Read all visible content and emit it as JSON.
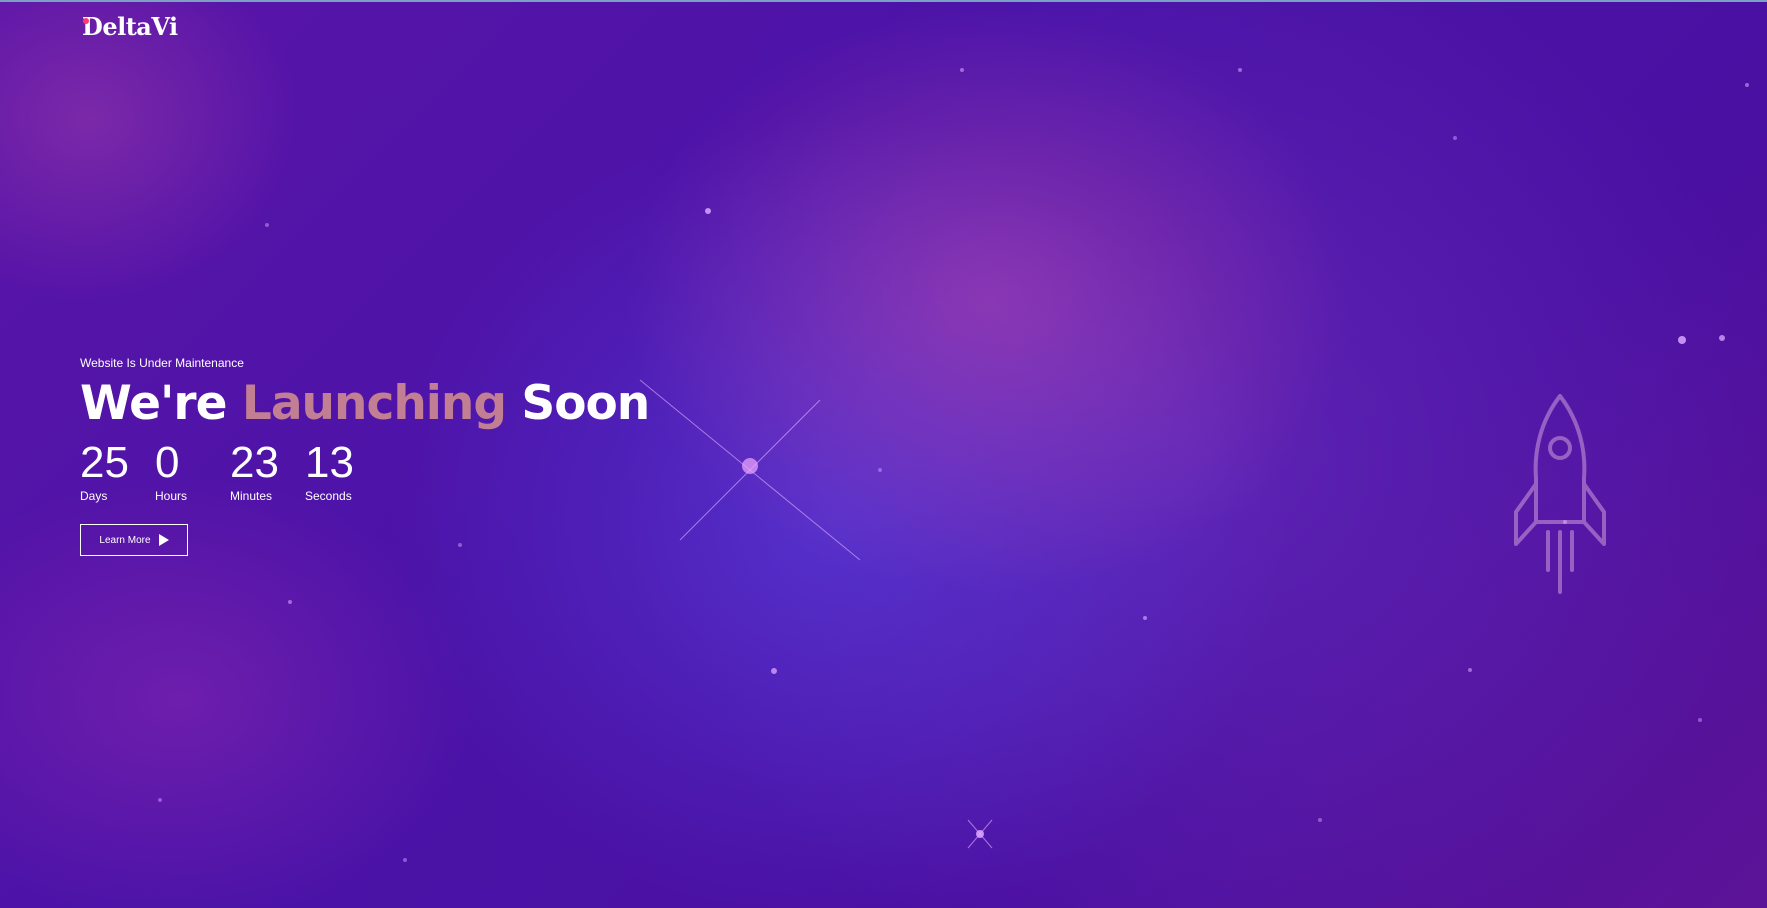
{
  "brand": {
    "name": "DeltaVi"
  },
  "hero": {
    "eyebrow": "Website Is Under Maintenance",
    "title_part1": "We're",
    "title_accent": "Launching",
    "title_part2": "Soon",
    "accent_color": "#c27e93"
  },
  "countdown": [
    {
      "value": "25",
      "label": "Days"
    },
    {
      "value": "0",
      "label": "Hours"
    },
    {
      "value": "23",
      "label": "Minutes"
    },
    {
      "value": "13",
      "label": "Seconds"
    }
  ],
  "cta": {
    "label": "Learn More",
    "icon": "play-icon"
  },
  "decor": {
    "icon": "rocket-icon",
    "background": "purple-nebula"
  }
}
